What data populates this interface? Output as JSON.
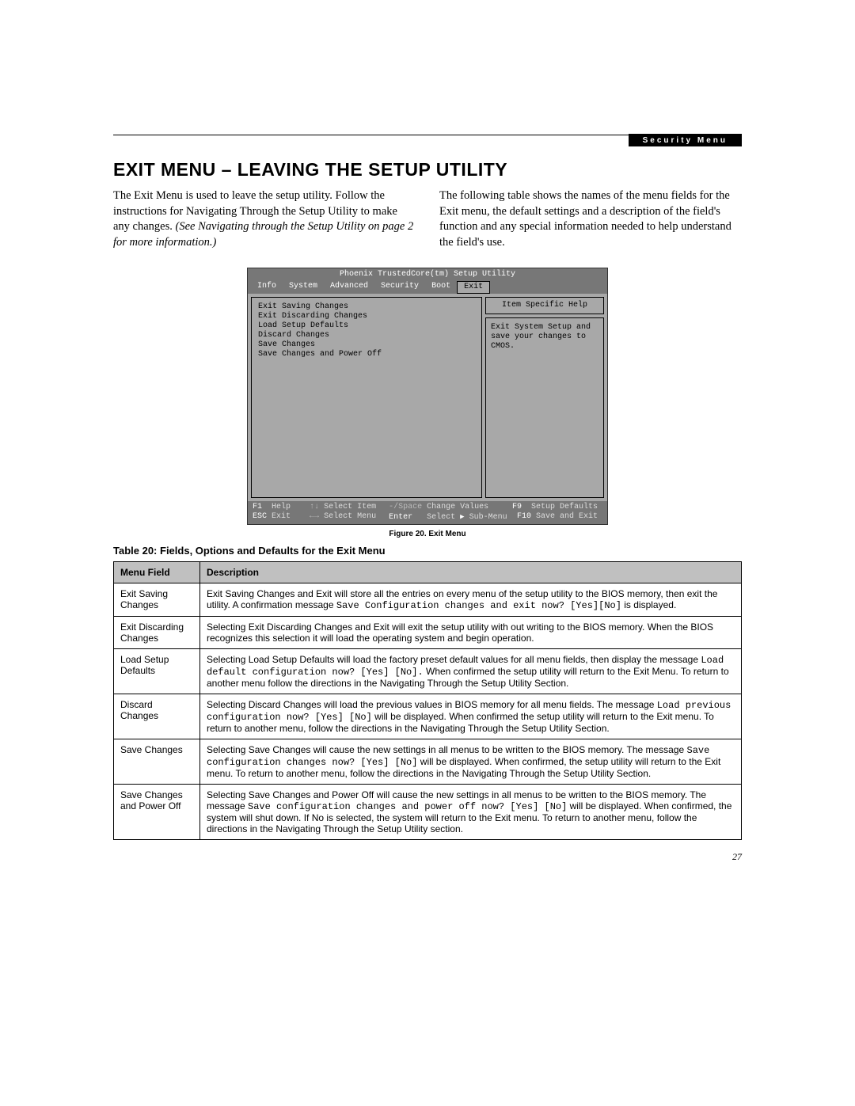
{
  "header": {
    "tab_label": "Security Menu"
  },
  "title": "EXIT MENU – LEAVING THE SETUP UTILITY",
  "intro": {
    "left_plain": "The Exit Menu is used to leave the setup utility. Follow the instructions for Navigating Through the Setup Utility to make any changes. ",
    "left_italic": "(See Navigating through the Setup Utility on page 2 for more information.)",
    "right": "The following table shows the names of the menu fields for the Exit menu, the default settings and a description of the field's function and any special information needed to help understand the field's use."
  },
  "bios": {
    "title": "Phoenix TrustedCore(tm) Setup Utility",
    "tabs": [
      "Info",
      "System",
      "Advanced",
      "Security",
      "Boot",
      "Exit"
    ],
    "active_tab": "Exit",
    "menu_items": [
      "Exit Saving Changes",
      "Exit Discarding Changes",
      "Load Setup Defaults",
      "Discard Changes",
      "Save Changes",
      "Save Changes and Power Off"
    ],
    "help_header": "Item Specific Help",
    "help_body": "Exit System Setup and save your changes to CMOS.",
    "footer": {
      "row1": {
        "k1": "F1",
        "l1": "Help",
        "k2": "↑↓",
        "l2": "Select Item",
        "k3": "-/Space",
        "l3": "Change Values",
        "k4": "F9",
        "l4": "Setup Defaults"
      },
      "row2": {
        "k1": "ESC",
        "l1": "Exit",
        "k2": "←→",
        "l2": "Select Menu",
        "k3": "Enter",
        "l3_a": "Select ",
        "l3_b": " Sub-Menu",
        "k4": "F10",
        "l4": "Save and Exit"
      }
    }
  },
  "figure_caption": "Figure 20.  Exit Menu",
  "table_title": "Table 20: Fields, Options and Defaults for the Exit Menu",
  "table": {
    "headers": [
      "Menu Field",
      "Description"
    ],
    "rows": [
      {
        "field": "Exit Saving Changes",
        "d1": "Exit Saving Changes and Exit will store all the entries on every menu of the setup utility to the BIOS memory, then exit the utility. A confirmation message ",
        "m1": "Save Configuration changes and exit now? [Yes][No]",
        "d2": " is displayed."
      },
      {
        "field": "Exit Discarding Changes",
        "d1": "Selecting Exit Discarding Changes and Exit will exit the setup utility with out writing to the BIOS memory. When the BIOS recognizes this selection it will load the operating system and begin operation.",
        "m1": "",
        "d2": ""
      },
      {
        "field": "Load Setup Defaults",
        "d1": "Selecting Load Setup Defaults will load the factory preset default values for all menu fields, then display the message ",
        "m1": "Load default configuration now? [Yes] [No].",
        "d2": " When confirmed the setup utility will return to the Exit Menu. To return to another menu follow the directions in the Navigating Through the Setup Utility Section."
      },
      {
        "field": "Discard Changes",
        "d1": "Selecting Discard Changes will load the previous values in BIOS memory for all menu fields. The message ",
        "m1": "Load previous configuration now? [Yes] [No]",
        "d2": " will be displayed. When confirmed the setup utility will return to the Exit menu. To return to another menu, follow the directions in the Navigating Through the Setup Utility Section."
      },
      {
        "field": "Save Changes",
        "d1": "Selecting Save Changes will cause the new settings in all menus to be written to the BIOS memory. The message ",
        "m1": "Save configuration changes now? [Yes] [No]",
        "d2": " will be displayed. When confirmed, the setup utility will return to the Exit menu. To return to another menu, follow the directions in the Navigating Through the Setup Utility Section."
      },
      {
        "field": "Save Changes and Power Off",
        "d1": "Selecting Save Changes and Power Off will cause the new settings in all menus to be written to the BIOS memory. The message ",
        "m1": "Save configuration changes and power off now? [Yes] [No]",
        "d2": " will be displayed. When confirmed, the system will shut down. If No is selected, the system will return to the Exit menu. To return to another menu, follow the directions in the Navigating Through the Setup Utility section."
      }
    ]
  },
  "page_number": "27"
}
